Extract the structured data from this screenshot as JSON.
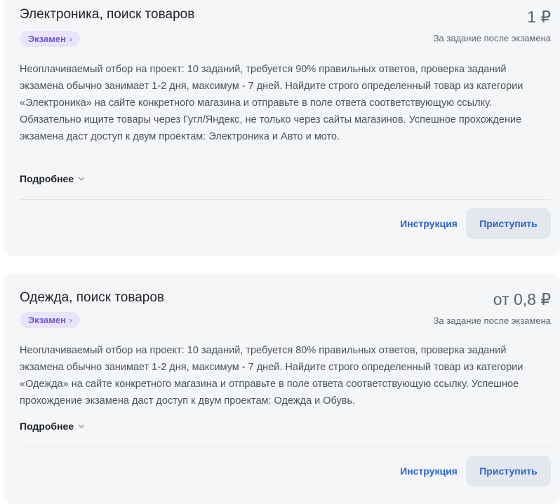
{
  "cards": [
    {
      "title": "Электроника, поиск товаров",
      "price": "1 ₽",
      "price_note": "За задание после экзамена",
      "badge": "Экзамен",
      "description": "Неоплачиваемый отбор на проект: 10 заданий, требуется 90% правильных ответов, проверка заданий экзамена обычно занимает 1-2 дня, максимум - 7 дней. Найдите строго определенный товар из категории «Электроника» на сайте конкретного магазина и отправьте в поле ответа соответствующую ссылку. Обязательно ищите товары через Гугл/Яндекс, не только через сайты магазинов. Успешное прохождение экзамена даст доступ к двум проектам: Электроника и Авто и мото.",
      "more_label": "Подробнее",
      "instruction_label": "Инструкция",
      "start_label": "Приступить"
    },
    {
      "title": "Одежда, поиск товаров",
      "price": "от 0,8 ₽",
      "price_note": "За задание после экзамена",
      "badge": "Экзамен",
      "description": "Неоплачиваемый отбор на проект: 10 заданий, требуется 80% правильных ответов, проверка заданий экзамена обычно занимает 1-2 дня, максимум - 7 дней. Найдите строго определенный товар из категории «Одежда» на сайте конкретного магазина и отправьте в поле ответа соответствующую ссылку. Успешное прохождение экзамена даст доступ к двум проектам: Одежда и Обувь.",
      "more_label": "Подробнее",
      "instruction_label": "Инструкция",
      "start_label": "Приступить"
    }
  ],
  "icons": {
    "badge_chevron": "chevron-right-icon",
    "more_chevron": "chevron-down-icon"
  },
  "colors": {
    "card_bg": "#f5f6f8",
    "badge_bg": "#e9e3fd",
    "badge_text": "#6f55d3",
    "link_blue": "#2a63d6",
    "start_button_bg": "#e4e8ee"
  }
}
